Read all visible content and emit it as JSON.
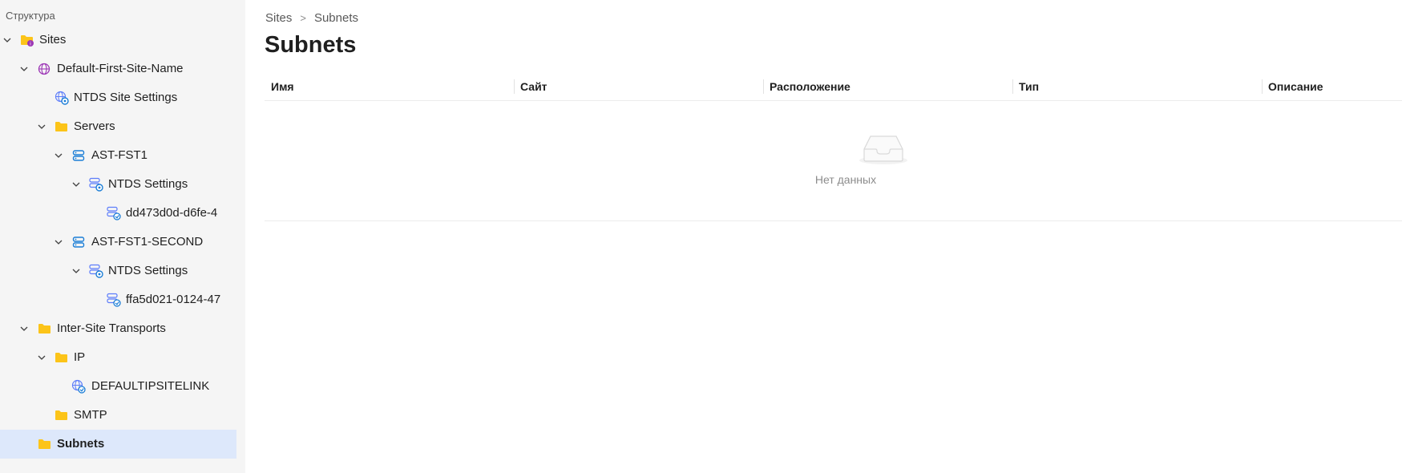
{
  "sidebar": {
    "title": "Структура",
    "tree": [
      {
        "label": "Sites",
        "icon": "sites-folder-icon",
        "expanded": true
      },
      {
        "label": "Default-First-Site-Name",
        "icon": "globe-icon",
        "expanded": true
      },
      {
        "label": "NTDS Site Settings",
        "icon": "globe-settings-icon"
      },
      {
        "label": "Servers",
        "icon": "folder-icon",
        "expanded": true
      },
      {
        "label": "AST-FST1",
        "icon": "server-icon",
        "expanded": true
      },
      {
        "label": "NTDS Settings",
        "icon": "server-settings-icon",
        "expanded": true
      },
      {
        "label": "dd473d0d-d6fe-4",
        "icon": "connection-icon"
      },
      {
        "label": "AST-FST1-SECOND",
        "icon": "server-icon",
        "expanded": true
      },
      {
        "label": "NTDS Settings",
        "icon": "server-settings-icon",
        "expanded": true
      },
      {
        "label": "ffa5d021-0124-47",
        "icon": "connection-icon"
      },
      {
        "label": "Inter-Site Transports",
        "icon": "folder-icon",
        "expanded": true
      },
      {
        "label": "IP",
        "icon": "folder-icon",
        "expanded": true
      },
      {
        "label": "DEFAULTIPSITELINK",
        "icon": "site-link-icon"
      },
      {
        "label": "SMTP",
        "icon": "folder-icon"
      },
      {
        "label": "Subnets",
        "icon": "folder-icon",
        "selected": true
      }
    ]
  },
  "breadcrumb": {
    "items": [
      "Sites",
      "Subnets"
    ],
    "separator": ">"
  },
  "page": {
    "title": "Subnets"
  },
  "table": {
    "columns": [
      "Имя",
      "Сайт",
      "Расположение",
      "Тип",
      "Описание"
    ],
    "rows": [],
    "empty_text": "Нет данных"
  },
  "colors": {
    "folder": "#fcc419",
    "selected_bg": "#dde8fb",
    "server_blue": "#1c7ed6",
    "globe_purple": "#9c36b5"
  }
}
